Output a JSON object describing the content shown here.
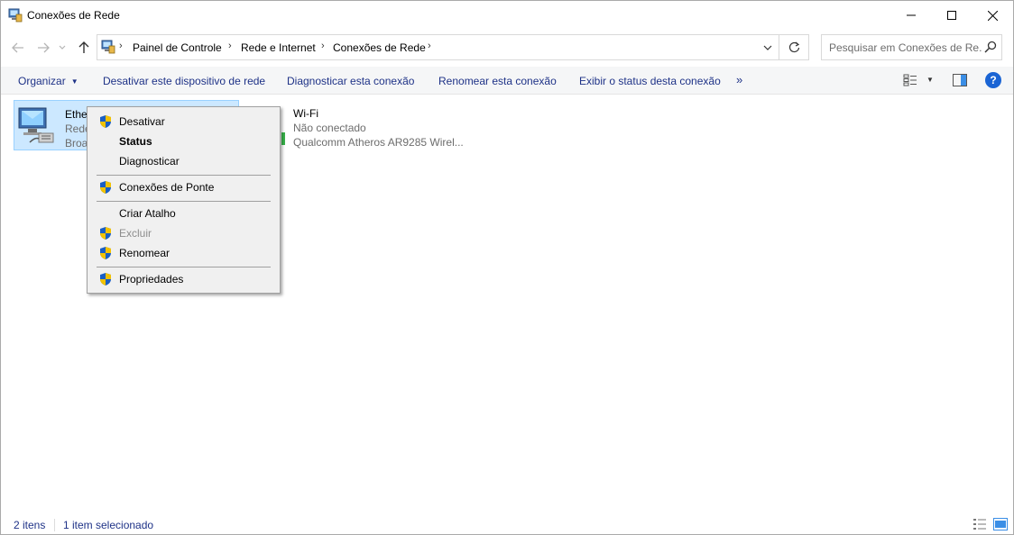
{
  "window": {
    "title": "Conexões de Rede",
    "icon": "network-connections-icon",
    "controls": [
      "minimize-icon",
      "maximize-icon",
      "close-icon"
    ]
  },
  "nav": {
    "breadcrumb": [
      "Painel de Controle",
      "Rede e Internet",
      "Conexões de Rede"
    ],
    "search_placeholder": "Pesquisar em Conexões de Re..."
  },
  "commands": {
    "organize": "Organizar",
    "disable_device": "Desativar este dispositivo de rede",
    "diagnose": "Diagnosticar esta conexão",
    "rename": "Renomear esta conexão",
    "view_status": "Exibir o status desta conexão",
    "more": "»"
  },
  "items": [
    {
      "name": "Ethernet",
      "name_visible": "Ethe",
      "status_visible": "Rede",
      "device_visible": "Broa",
      "selected": true
    },
    {
      "name": "Wi-Fi",
      "status": "Não conectado",
      "device": "Qualcomm Atheros AR9285 Wirel...",
      "selected": false
    }
  ],
  "context_menu": {
    "items": [
      {
        "label": "Desativar",
        "shield": true,
        "bold": false,
        "disabled": false
      },
      {
        "label": "Status",
        "shield": false,
        "bold": true,
        "disabled": false
      },
      {
        "label": "Diagnosticar",
        "shield": false,
        "bold": false,
        "disabled": false
      },
      {
        "label": "Conexões de Ponte",
        "shield": true,
        "bold": false,
        "disabled": false
      },
      {
        "label": "Criar Atalho",
        "shield": false,
        "bold": false,
        "disabled": false
      },
      {
        "label": "Excluir",
        "shield": true,
        "bold": false,
        "disabled": true
      },
      {
        "label": "Renomear",
        "shield": true,
        "bold": false,
        "disabled": false
      },
      {
        "label": "Propriedades",
        "shield": true,
        "bold": false,
        "disabled": false
      }
    ]
  },
  "status_bar": {
    "count": "2 itens",
    "selection": "1 item selecionado"
  },
  "colors": {
    "link_blue": "#1e3287",
    "selection_bg": "#cce8ff",
    "selection_border": "#99d1ff",
    "help_blue": "#1a64d4"
  }
}
